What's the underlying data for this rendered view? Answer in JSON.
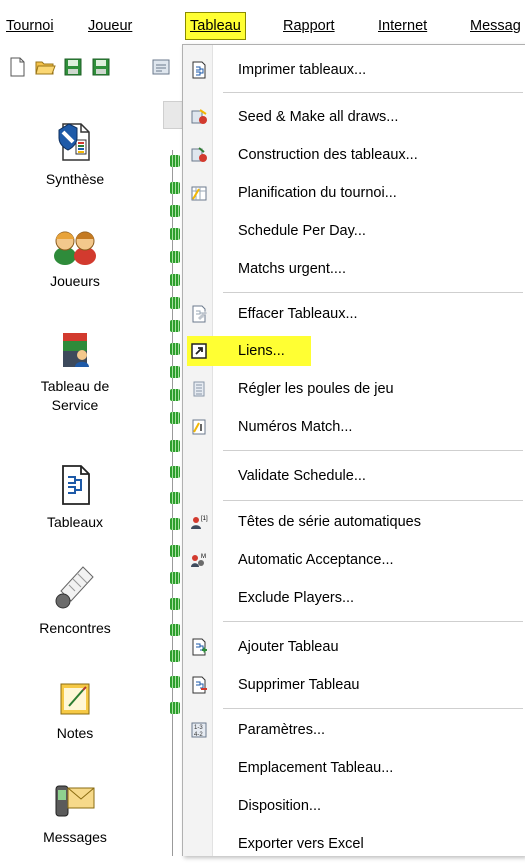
{
  "menubar": {
    "items": [
      {
        "label": "Tournoi",
        "active": false
      },
      {
        "label": "Joueur",
        "active": false
      },
      {
        "label": "Tableau",
        "active": true
      },
      {
        "label": "Rapport",
        "active": false
      },
      {
        "label": "Internet",
        "active": false
      },
      {
        "label": "Messag",
        "active": false
      }
    ]
  },
  "toolbar": {
    "icons": [
      "new-file-icon",
      "open-folder-icon",
      "save-icon",
      "save-as-icon",
      "properties-icon"
    ]
  },
  "sidebar": {
    "items": [
      {
        "label": "Synthèse",
        "icon": "summary-icon"
      },
      {
        "label": "Joueurs",
        "icon": "players-icon"
      },
      {
        "label": "Tableau de Service",
        "icon": "service-desk-icon"
      },
      {
        "label": "Tableaux",
        "icon": "draws-icon"
      },
      {
        "label": "Rencontres",
        "icon": "shuttlecock-icon"
      },
      {
        "label": "Notes",
        "icon": "notes-icon"
      },
      {
        "label": "Messages",
        "icon": "messages-icon"
      }
    ]
  },
  "dropdown": {
    "items": [
      {
        "label": "Imprimer tableaux...",
        "icon": "print-draws-icon"
      },
      {
        "label": "Seed & Make all draws...",
        "icon": "seed-draws-icon"
      },
      {
        "label": "Construction des tableaux...",
        "icon": "build-draws-icon"
      },
      {
        "label": "Planification du tournoi...",
        "icon": "schedule-icon"
      },
      {
        "label": "Schedule Per Day...",
        "icon": ""
      },
      {
        "label": "Matchs urgent....",
        "icon": ""
      },
      {
        "label": "Effacer Tableaux...",
        "icon": "clear-draws-icon"
      },
      {
        "label": "Liens...",
        "icon": "link-icon",
        "highlighted": true
      },
      {
        "label": "Régler les poules de jeu",
        "icon": "pools-icon"
      },
      {
        "label": "Numéros Match...",
        "icon": "match-numbers-icon"
      },
      {
        "label": "Validate Schedule...",
        "icon": ""
      },
      {
        "label": "Têtes de série automatiques",
        "icon": "auto-seeding-icon"
      },
      {
        "label": "Automatic Acceptance...",
        "icon": "auto-acceptance-icon"
      },
      {
        "label": "Exclude Players...",
        "icon": ""
      },
      {
        "label": "Ajouter Tableau",
        "icon": "add-draw-icon"
      },
      {
        "label": "Supprimer Tableau",
        "icon": "delete-draw-icon"
      },
      {
        "label": "Paramètres...",
        "icon": "parameters-icon"
      },
      {
        "label": "Emplacement Tableau...",
        "icon": ""
      },
      {
        "label": "Disposition...",
        "icon": ""
      },
      {
        "label": "Exporter vers Excel",
        "icon": ""
      }
    ]
  },
  "colors": {
    "highlight": "#ffff33",
    "menu_border": "#b0b0b0",
    "icon_column": "#f3f3f3"
  }
}
